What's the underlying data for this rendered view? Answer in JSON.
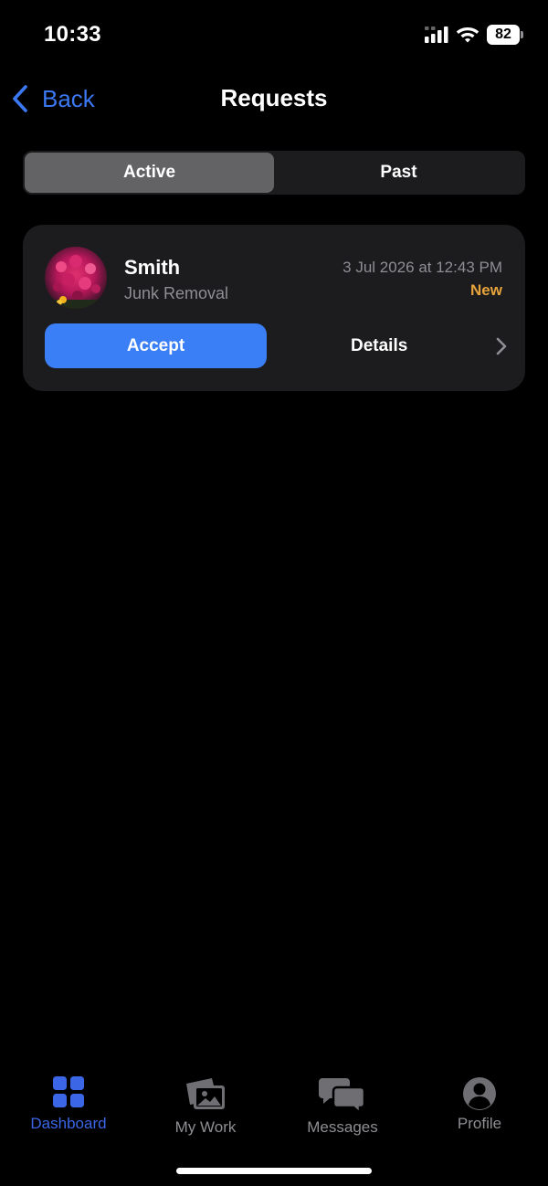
{
  "status_bar": {
    "time": "10:33",
    "battery": "82"
  },
  "nav": {
    "back_label": "Back",
    "title": "Requests"
  },
  "segments": {
    "active_label": "Active",
    "past_label": "Past",
    "selected": "Active"
  },
  "requests": [
    {
      "name": "Smith",
      "service": "Junk Removal",
      "date": "3 Jul 2026 at 12:43 PM",
      "badge": "New",
      "accept_label": "Accept",
      "details_label": "Details"
    }
  ],
  "tabs": [
    {
      "label": "Dashboard",
      "icon": "grid-icon",
      "active": true
    },
    {
      "label": "My Work",
      "icon": "photos-icon",
      "active": false
    },
    {
      "label": "Messages",
      "icon": "chat-bubbles-icon",
      "active": false
    },
    {
      "label": "Profile",
      "icon": "person-circle-icon",
      "active": false
    }
  ],
  "colors": {
    "accent": "#3a7ff6",
    "badge": "#e7a43c",
    "tab_active": "#3b66e6",
    "card_bg": "#1c1c1e"
  }
}
